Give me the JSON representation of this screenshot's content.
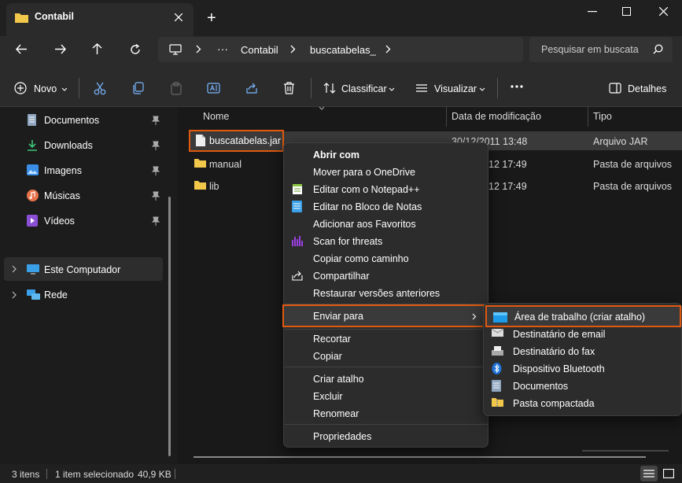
{
  "window": {
    "tab_title": "Contabil",
    "new_tab": "+"
  },
  "address": {
    "breadcrumbs": [
      "Contabil",
      "buscatabelas_"
    ],
    "search_placeholder": "Pesquisar em buscata"
  },
  "toolbar": {
    "new": "Novo",
    "sort": "Classificar",
    "view": "Visualizar",
    "details": "Detalhes"
  },
  "sidebar": {
    "items": [
      {
        "label": "Documentos",
        "icon": "document-icon"
      },
      {
        "label": "Downloads",
        "icon": "download-icon"
      },
      {
        "label": "Imagens",
        "icon": "image-icon"
      },
      {
        "label": "Músicas",
        "icon": "music-icon"
      },
      {
        "label": "Vídeos",
        "icon": "video-icon"
      },
      {
        "label": "Este Computador",
        "icon": "computer-icon"
      },
      {
        "label": "Rede",
        "icon": "network-icon"
      }
    ]
  },
  "columns": {
    "name": "Nome",
    "date": "Data de modificação",
    "type": "Tipo"
  },
  "files": [
    {
      "name": "buscatabelas.jar",
      "date": "30/12/2011 13:48",
      "type": "Arquivo JAR"
    },
    {
      "name": "manual",
      "date": "12 17:49",
      "type": "Pasta de arquivos"
    },
    {
      "name": "lib",
      "date": "12 17:49",
      "type": "Pasta de arquivos"
    }
  ],
  "context_menu": {
    "open_with": "Abrir com",
    "move_onedrive": "Mover para o OneDrive",
    "edit_npp": "Editar com o Notepad++",
    "edit_notepad": "Editar no Bloco de Notas",
    "add_favorites": "Adicionar aos Favoritos",
    "scan": "Scan for threats",
    "copy_path": "Copiar como caminho",
    "share": "Compartilhar",
    "restore": "Restaurar versões anteriores",
    "send_to": "Enviar para",
    "cut": "Recortar",
    "copy": "Copiar",
    "shortcut": "Criar atalho",
    "delete": "Excluir",
    "rename": "Renomear",
    "properties": "Propriedades"
  },
  "submenu": {
    "desktop": "Área de trabalho (criar atalho)",
    "email": "Destinatário de email",
    "fax": "Destinatário do fax",
    "bluetooth": "Dispositivo Bluetooth",
    "documents": "Documentos",
    "zip": "Pasta compactada"
  },
  "status": {
    "count": "3 itens",
    "selected": "1 item selecionado",
    "size": "40,9 KB"
  }
}
